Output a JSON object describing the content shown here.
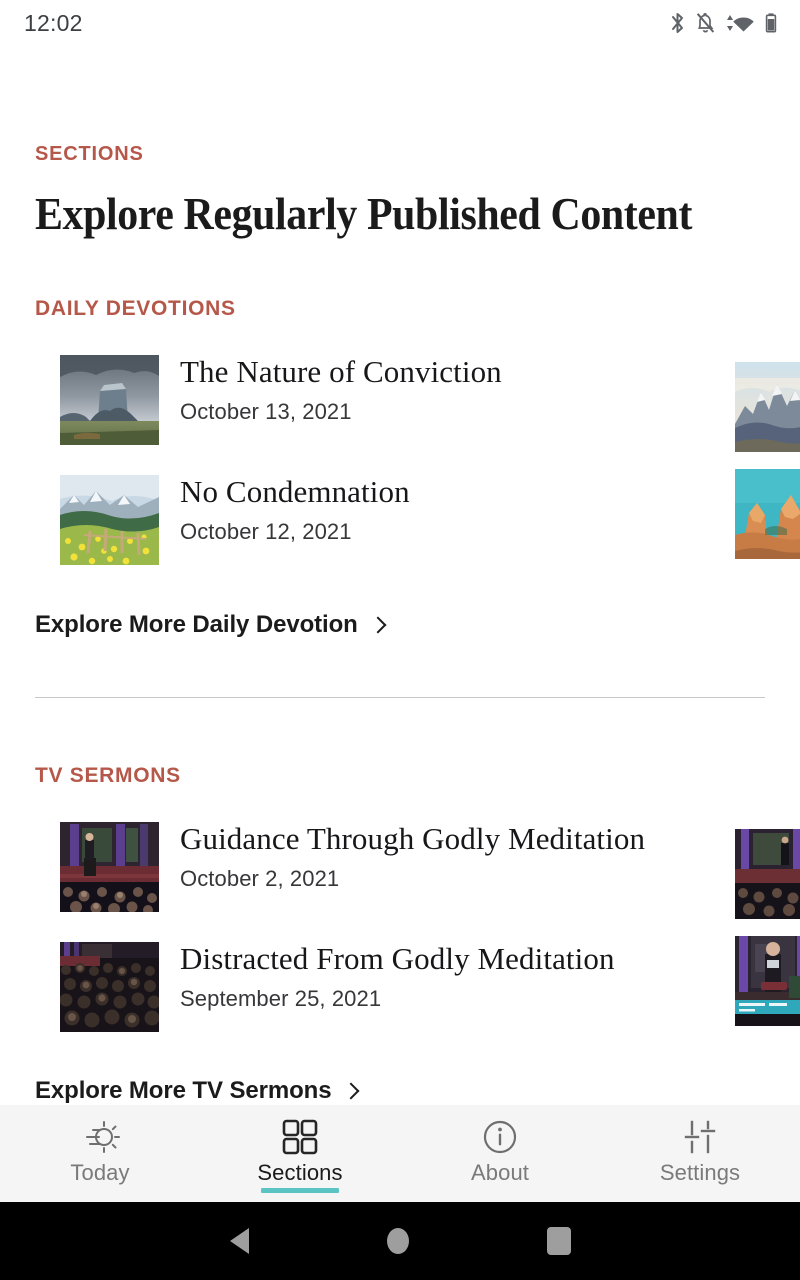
{
  "status_bar": {
    "time": "12:02",
    "icons": [
      "bluetooth-icon",
      "notifications-off-icon",
      "wifi-data-icon",
      "battery-icon"
    ]
  },
  "header": {
    "eyebrow": "SECTIONS",
    "title": "Explore Regularly Published Content"
  },
  "accent_colors": {
    "section_heading": "#b5584a",
    "tab_indicator": "#5cc4c2"
  },
  "sections": [
    {
      "heading": "DAILY DEVOTIONS",
      "items": [
        {
          "title": "The Nature of Conviction",
          "date": "October 13, 2021",
          "thumb": "butte-stormy-sky-thumb"
        },
        {
          "title": "No Condemnation",
          "date": "October 12, 2021",
          "thumb": "wildflower-meadow-thumb"
        }
      ],
      "peek_items": [
        {
          "thumb": "jagged-snow-peaks-thumb"
        },
        {
          "thumb": "orange-rock-spires-thumb"
        }
      ],
      "explore_label": "Explore More Daily Devotion"
    },
    {
      "heading": "TV SERMONS",
      "items": [
        {
          "title": "Guidance Through Godly Meditation",
          "date": "October 2, 2021",
          "thumb": "sanctuary-pulpit-thumb"
        },
        {
          "title": "Distracted From Godly Meditation",
          "date": "September 25, 2021",
          "thumb": "congregation-crowd-thumb"
        }
      ],
      "peek_items": [
        {
          "thumb": "sanctuary-columns-thumb"
        },
        {
          "thumb": "preacher-lower-third-thumb"
        }
      ],
      "explore_label": "Explore More TV Sermons"
    }
  ],
  "tabbar": {
    "tabs": [
      {
        "label": "Today",
        "icon": "sunrise-icon",
        "active": false
      },
      {
        "label": "Sections",
        "icon": "grid-icon",
        "active": true
      },
      {
        "label": "About",
        "icon": "info-circle-icon",
        "active": false
      },
      {
        "label": "Settings",
        "icon": "sliders-icon",
        "active": false
      }
    ]
  },
  "android_nav": {
    "buttons": [
      "back-button",
      "home-button",
      "recents-button"
    ]
  }
}
